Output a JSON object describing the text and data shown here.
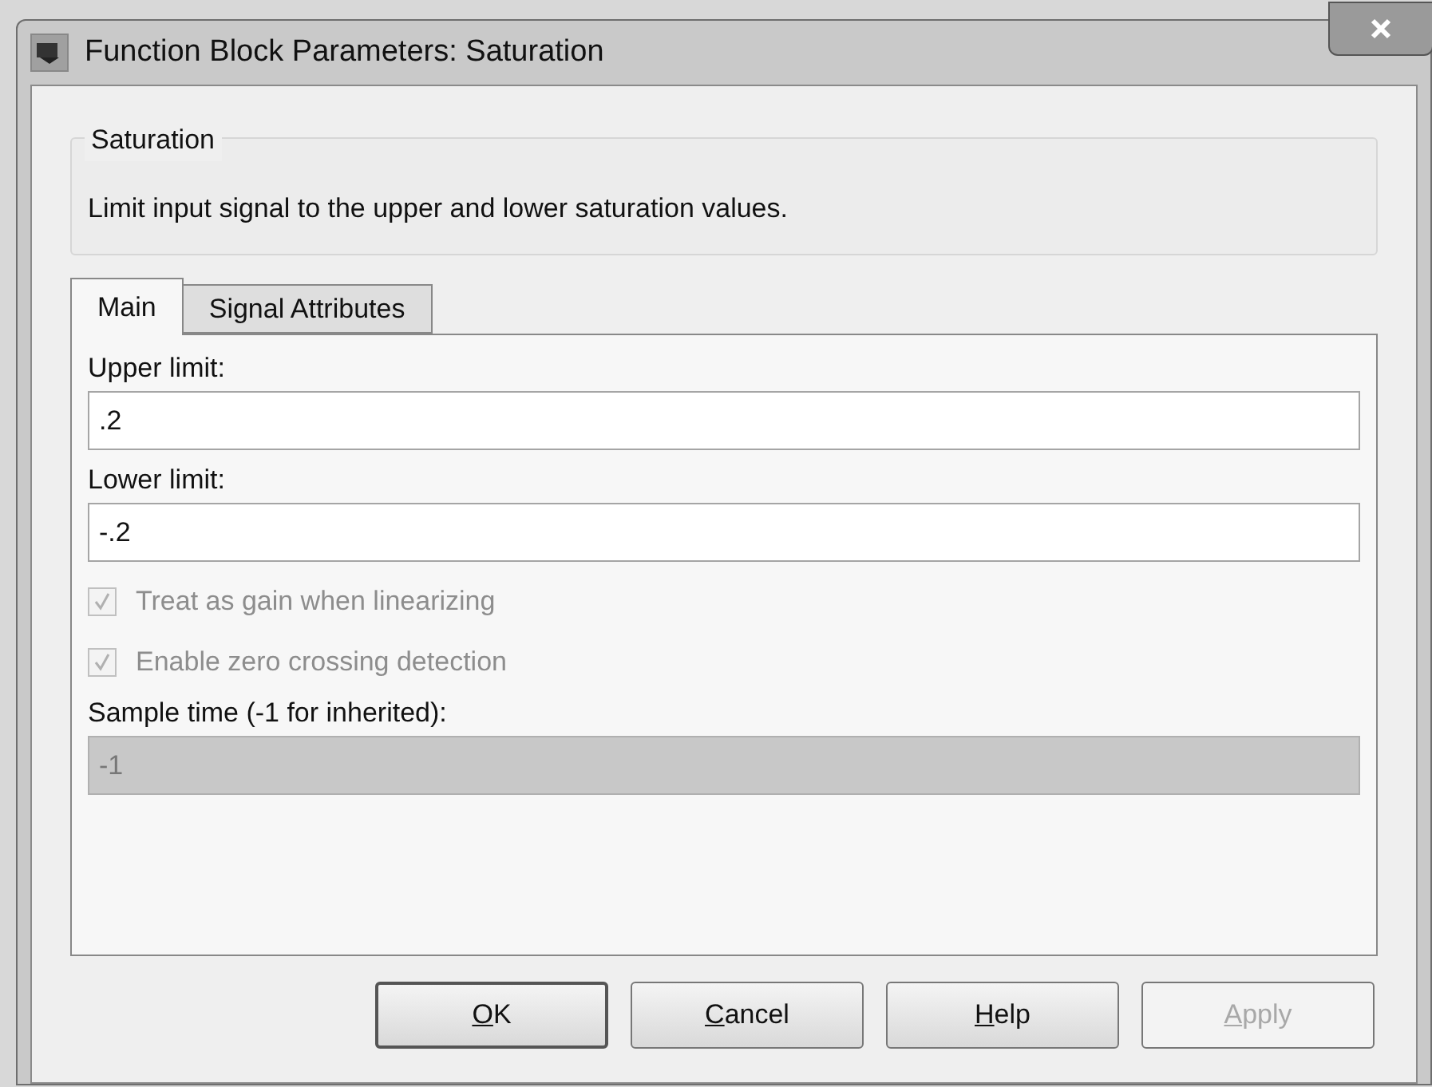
{
  "window": {
    "title": "Function Block Parameters: Saturation"
  },
  "group": {
    "title": "Saturation",
    "description": "Limit input signal to the upper and lower saturation values."
  },
  "tabs": [
    {
      "label": "Main",
      "selected": true
    },
    {
      "label": "Signal Attributes",
      "selected": false
    }
  ],
  "fields": [
    {
      "kind": "text",
      "label": "Upper limit:",
      "value": ".2",
      "disabled": false
    },
    {
      "kind": "text",
      "label": "Lower limit:",
      "value": "-.2",
      "disabled": false
    },
    {
      "kind": "checkbox",
      "label": "Treat as gain when linearizing",
      "checked": true,
      "disabled": true
    },
    {
      "kind": "checkbox",
      "label": "Enable zero crossing detection",
      "checked": true,
      "disabled": true
    },
    {
      "kind": "text",
      "label": "Sample time (-1 for inherited):",
      "value": "-1",
      "disabled": true
    }
  ],
  "buttons": [
    {
      "label": "OK",
      "default": true,
      "disabled": false
    },
    {
      "label": "Cancel",
      "default": false,
      "disabled": false
    },
    {
      "label": "Help",
      "default": false,
      "disabled": false
    },
    {
      "label": "Apply",
      "default": false,
      "disabled": true
    }
  ]
}
